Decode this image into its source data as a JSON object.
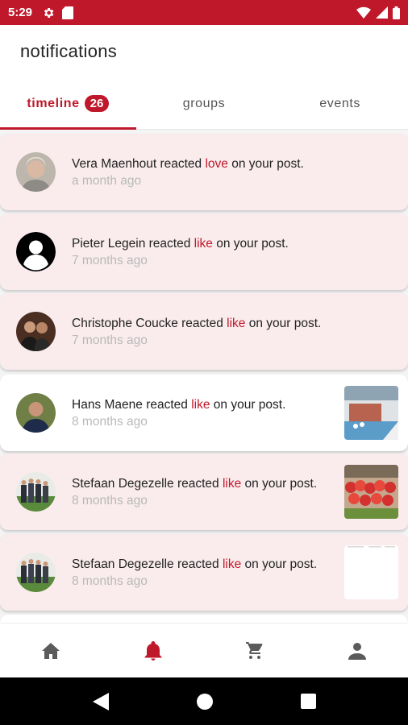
{
  "status_bar": {
    "time": "5:29"
  },
  "header": {
    "title": "notifications"
  },
  "tabs": [
    {
      "label": "timeline",
      "badge": "26"
    },
    {
      "label": "groups"
    },
    {
      "label": "events"
    }
  ],
  "notifications": [
    {
      "name": "Vera Maenhout",
      "text": " reacted ",
      "reaction": "love",
      "suffix": " on your post.",
      "time": "a month ago"
    },
    {
      "name": "Pieter Legein",
      "text": " reacted ",
      "reaction": "like",
      "suffix": " on your post.",
      "time": "7 months ago"
    },
    {
      "name": "Christophe Coucke",
      "text": " reacted ",
      "reaction": "like",
      "suffix": " on your post.",
      "time": "7 months ago"
    },
    {
      "name": "Hans Maene",
      "text": " reacted ",
      "reaction": "like",
      "suffix": " on your post.",
      "time": "8 months ago"
    },
    {
      "name": "Stefaan Degezelle",
      "text": " reacted ",
      "reaction": "like",
      "suffix": " on your post.",
      "time": "8 months ago"
    },
    {
      "name": "Stefaan Degezelle",
      "text": " reacted ",
      "reaction": "like",
      "suffix": " on your post.",
      "time": "8 months ago"
    }
  ],
  "bottom_nav": [
    "home-icon",
    "bell-icon",
    "cart-icon",
    "person-icon"
  ],
  "colors": {
    "accent": "#c0182b",
    "unread_bg": "#faeced",
    "muted": "#b9b9b9"
  }
}
